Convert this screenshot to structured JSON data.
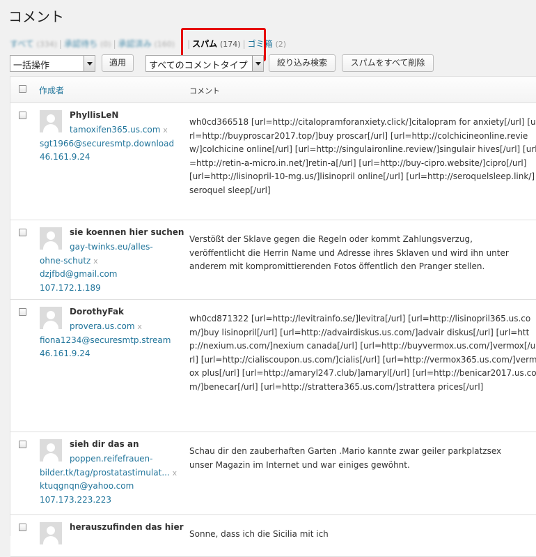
{
  "page": {
    "title": "コメント"
  },
  "filters": [
    {
      "label": "すべて",
      "count": "(334)",
      "blurred": true,
      "current": false
    },
    {
      "label": "承認待ち",
      "count": "(0)",
      "blurred": true,
      "current": false
    },
    {
      "label": "承認済み",
      "count": "(160)",
      "blurred": true,
      "current": false
    },
    {
      "label": "スパム",
      "count": "(174)",
      "blurred": false,
      "current": true
    },
    {
      "label": "ゴミ箱",
      "count": "(2)",
      "blurred": false,
      "current": false
    }
  ],
  "toolbar": {
    "bulk_action": "一括操作",
    "apply": "適用",
    "comment_type": "すべてのコメントタイプ",
    "filter": "絞り込み検索",
    "delete_all_spam": "スパムをすべて削除"
  },
  "table": {
    "col_author": "作成者",
    "col_comment": "コメント",
    "rows": [
      {
        "name": "PhyllisLeN",
        "url_lines": [
          "tamoxifen365.us.com"
        ],
        "x": "x",
        "email": "sgt1966@securesmtp.download",
        "ip": "46.161.9.24",
        "comment": "wh0cd366518 [url=http://citalopramforanxiety.click/]citalopram for anxiety[/url] [url=http://buyproscar2017.top/]buy proscar[/url] [url=http://colchicineonline.review/]colchicine online[/url] [url=http://singulaironline.review/]singulair hives[/url] [url=http://retin-a-micro.in.net/]retin-a[/url] [url=http://buy-cipro.website/]cipro[/url] [url=http://lisinopril-10-mg.us/]lisinopril online[/url] [url=http://seroquelsleep.link/]seroquel sleep[/url]"
      },
      {
        "name": "sie koennen hier suchen",
        "url_lines": [
          "gay-twinks.eu/alles-",
          "ohne-schutz"
        ],
        "x": "x",
        "email": "dzjfbd@gmail.com",
        "ip": "107.172.1.189",
        "comment": "Verstößt der Sklave gegen die Regeln oder kommt Zahlungsverzug, veröffentlicht die Herrin Name und Adresse ihres Sklaven und wird ihn unter anderem mit kompromittierenden Fotos öffentlich den Pranger stellen."
      },
      {
        "name": "DorothyFak",
        "url_lines": [
          "provera.us.com"
        ],
        "x": "x",
        "email": "fiona1234@securesmtp.stream",
        "ip": "46.161.9.24",
        "comment": "wh0cd871322 [url=http://levitrainfo.se/]levitra[/url] [url=http://lisinopril365.us.com/]buy lisinopril[/url] [url=http://advairdiskus.us.com/]advair diskus[/url] [url=http://nexium.us.com/]nexium canada[/url] [url=http://buyvermox.us.com/]vermox[/url] [url=http://cialiscoupon.us.com/]cialis[/url] [url=http://vermox365.us.com/]vermox plus[/url] [url=http://amaryl247.club/]amaryl[/url] [url=http://benicar2017.us.com/]benecar[/url] [url=http://strattera365.us.com/]strattera prices[/url]"
      },
      {
        "name": "sieh dir das an",
        "url_lines": [
          "poppen.reifefrauen-",
          "bilder.tk/tag/prostatastimulat..."
        ],
        "x": "x",
        "email": "ktuqgnqn@yahoo.com",
        "ip": "107.173.223.223",
        "comment": "Schau dir den zauberhaften Garten .Mario kannte zwar geiler parkplatzsex unser Magazin im Internet und war einiges gewöhnt."
      },
      {
        "name": "herauszufinden das hier",
        "url_lines": [],
        "x": "",
        "email": "",
        "ip": "",
        "comment": "Sonne, dass ich die Sicilia mit ich"
      }
    ]
  }
}
